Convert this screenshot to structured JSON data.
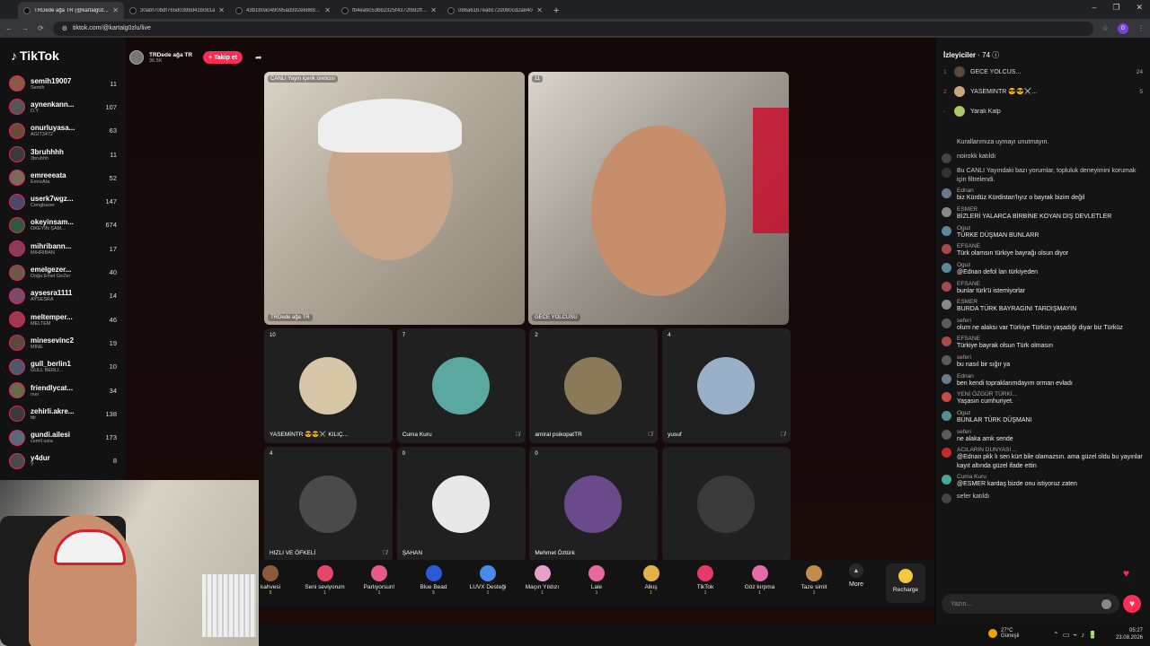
{
  "browser": {
    "tabs": [
      {
        "title": "TRDede ağa TR (@kartalg0z...",
        "active": true
      },
      {
        "title": "30abf70bdf765d0398d41b081a...",
        "active": false
      },
      {
        "title": "43b1b0a049095ad392e6869...",
        "active": false
      },
      {
        "title": "fb4ea9c53bb2325f4372fb92ff...",
        "active": false
      },
      {
        "title": "086a61b7eabc72d080cd2a840...",
        "active": false
      }
    ],
    "url": "tiktok.com/@kartalg0zlu/live",
    "profile_initial": "G"
  },
  "sidebar": {
    "logo": "TikTok",
    "following": [
      {
        "name": "semih19007",
        "sub": "Semih",
        "count": "11",
        "color": "#8a5a44"
      },
      {
        "name": "aynenkann...",
        "sub": "D.Y",
        "count": "107",
        "color": "#555"
      },
      {
        "name": "onurluyasa...",
        "sub": "AĞIT3472",
        "count": "63",
        "color": "#6b4a3a"
      },
      {
        "name": "3bruhhhh",
        "sub": "3bruhhh",
        "count": "11",
        "color": "#3a3a3a"
      },
      {
        "name": "emreeeata",
        "sub": "EmreAta",
        "count": "52",
        "color": "#7a6a5a"
      },
      {
        "name": "userk7wgz...",
        "sub": "Cengbazer",
        "count": "147",
        "color": "#4a4a6a"
      },
      {
        "name": "okeyinsam...",
        "sub": "OKEYİN ŞAM...",
        "count": "674",
        "color": "#2f5a3a"
      },
      {
        "name": "mihribann...",
        "sub": "MİHRİBAN",
        "count": "17",
        "color": "#8a3a5a"
      },
      {
        "name": "emelgezer...",
        "sub": "Doğa Emel GeZer",
        "count": "40",
        "color": "#6a5a4a"
      },
      {
        "name": "aysesra1111",
        "sub": "AYSESRA",
        "count": "14",
        "color": "#7a4a6a"
      },
      {
        "name": "meltemper...",
        "sub": "MELTEM",
        "count": "46",
        "color": "#a03a4a"
      },
      {
        "name": "minesevinc2",
        "sub": "MİNE",
        "count": "19",
        "color": "#5a4a3a"
      },
      {
        "name": "gull_berlin1",
        "sub": "GÜLL BERLİ...",
        "count": "10",
        "color": "#4a5a6a"
      },
      {
        "name": "friendlycat...",
        "sub": "mei",
        "count": "34",
        "color": "#6a6a4a"
      },
      {
        "name": "zehirli.akre...",
        "sub": "ttir",
        "count": "138",
        "color": "#3a3a3a"
      },
      {
        "name": "gundi.ailesi",
        "sub": "cemil usta",
        "count": "173",
        "color": "#5a6a7a"
      },
      {
        "name": "y4dur",
        "sub": "Y",
        "count": "8",
        "color": "#4a4a4a"
      }
    ]
  },
  "live": {
    "host_name": "TRDede ağa TR",
    "host_viewers": "36.5K",
    "follow_label": "+ Takip et",
    "main_tiles": [
      {
        "badge": "CANLI Yayın içerik üreticisi",
        "name": "TRDede ağa TR"
      },
      {
        "badge": "11",
        "name": "GECE YOLCUSU"
      }
    ],
    "small_tiles": [
      {
        "count": "10",
        "name": "YASEMİNTR 😎😎⚔️ KILIÇ...",
        "color": "#d8c7a6",
        "muted": false
      },
      {
        "count": "7",
        "name": "Cuma Kuru",
        "color": "#5aa8a0",
        "muted": true
      },
      {
        "count": "2",
        "name": "amiral psikopatTR",
        "color": "#8a7a5a",
        "muted": true
      },
      {
        "count": "4",
        "name": "yusuf",
        "color": "#9ab0c8",
        "muted": true
      },
      {
        "count": "4",
        "name": "HIZLI VE ÖFKELİ",
        "color": "#4a4a4a",
        "muted": true
      },
      {
        "count": "0",
        "name": "ŞAHAN",
        "color": "#e8e8e8",
        "muted": false
      },
      {
        "count": "0",
        "name": "Mehmet Öztürk",
        "color": "#6a4a8a",
        "muted": false
      },
      {
        "count": "",
        "name": "",
        "color": "#3a3a3a",
        "muted": false
      }
    ]
  },
  "gifts": {
    "items": [
      {
        "name": "kahvesi",
        "price": "5",
        "color": "#8a5a3a"
      },
      {
        "name": "Seni seviyorum",
        "price": "1",
        "color": "#e8476a"
      },
      {
        "name": "Parlıyorsun!",
        "price": "1",
        "color": "#e85a8a"
      },
      {
        "name": "Blue Bead",
        "price": "5",
        "color": "#2a5ad8"
      },
      {
        "name": "LUVX Desteği",
        "price": "1",
        "color": "#4a8ae8"
      },
      {
        "name": "Maçın Yıldızı",
        "price": "1",
        "color": "#e8a0c8"
      },
      {
        "name": "Lale",
        "price": "1",
        "color": "#e86a9a"
      },
      {
        "name": "Alkış",
        "price": "1",
        "color": "#e8b04a"
      },
      {
        "name": "TikTok",
        "price": "1",
        "color": "#e83a6a"
      },
      {
        "name": "Göz kırpma",
        "price": "1",
        "color": "#e86aa8"
      },
      {
        "name": "Taze simit",
        "price": "1",
        "color": "#c88a4a"
      }
    ],
    "more_label": "More",
    "recharge_label": "Recharge"
  },
  "chat": {
    "viewers_label": "İzleyiciler",
    "viewers_count": "74",
    "top_viewers": [
      {
        "rank": "1",
        "name": "GECE YOLCUS...",
        "score": "24",
        "color": "#5a4a3a"
      },
      {
        "rank": "2",
        "name": "YASEMİNTR 😎😎⚔️...",
        "score": "5",
        "color": "#c8a87a"
      },
      {
        "rank": "-",
        "name": "Yaralı Kalp",
        "score": "",
        "color": "#a8c86a"
      }
    ],
    "messages": [
      {
        "user": "",
        "text": "Kurallarımıza uymayı unutmayın.",
        "color": "",
        "sys": true
      },
      {
        "user": "",
        "text": "noirokk  katıldı",
        "color": "#444",
        "sys": true
      },
      {
        "user": "",
        "text": "Bu CANLI Yayındaki bazı yorumlar, topluluk deneyimini korumak için filtrelendi.",
        "color": "#333",
        "sys": true
      },
      {
        "user": "Ednan",
        "text": "biz Kürdüz Kürdistan'lıyız o bayrak bizim değil",
        "color": "#6a7a8a",
        "sys": false
      },
      {
        "user": "ESMER",
        "text": "BİZLERİ YALARCA BİRBİNE KOYAN DIŞ DEVLETLER",
        "color": "#888",
        "sys": false
      },
      {
        "user": "Oguz",
        "text": "TÜRKE DÜŞMAN BUNLARR",
        "color": "#5a8a9a",
        "sys": false
      },
      {
        "user": "EFSANE",
        "text": "Türk olamsın türkiye bayrağı olsun diyor",
        "color": "#a84a4a",
        "sys": false
      },
      {
        "user": "Oguz",
        "text": "@Ednan  defol lan türkiyeden",
        "color": "#5a8a9a",
        "sys": false
      },
      {
        "user": "EFSANE",
        "text": "bunlar türk'ü istemiyorlar",
        "color": "#a84a4a",
        "sys": false
      },
      {
        "user": "ESMER",
        "text": "BURDA TÜRK BAYRAGINI TARDIŞMAYIN",
        "color": "#888",
        "sys": false
      },
      {
        "user": "seferi",
        "text": "olum ne alaksı var Türkiye Türkün yaşadığı diyar biz Türküz",
        "color": "#5a5a5a",
        "sys": false
      },
      {
        "user": "EFSANE",
        "text": "Türkiye bayrak olsun Türk olmasın",
        "color": "#a84a4a",
        "sys": false
      },
      {
        "user": "seferi",
        "text": "bu nasıl bir sığır ya",
        "color": "#5a5a5a",
        "sys": false
      },
      {
        "user": "Ednan",
        "text": "ben kendi topraklarımdayım orman evladı",
        "color": "#6a7a8a",
        "sys": false
      },
      {
        "user": "YENİ ÖZGÜR TÜRKİ...",
        "text": "Yaşasın cumhuriyet.",
        "color": "#c84a4a",
        "sys": false
      },
      {
        "user": "Oguz",
        "text": "BUNLAR TÜRK DÜŞMANI",
        "color": "#5a8a9a",
        "sys": false
      },
      {
        "user": "seferi",
        "text": "ne alaka amk sende",
        "color": "#5a5a5a",
        "sys": false
      },
      {
        "user": "ACILARIN DUNYASI ...",
        "text": "@Ednan  pkk lı sen kürt bile olamazsın. ama güzel oldu bu yayınlar kayıt altında güzel ifade ettin",
        "color": "#c82a2a",
        "sys": false
      },
      {
        "user": "Cuma Kuru",
        "text": "@ESMER kardaş bizde onu istiyoruz zaten",
        "color": "#4aa89a",
        "sys": false
      },
      {
        "user": "",
        "text": "sefer  katıldı",
        "color": "#444",
        "sys": true
      }
    ],
    "input_placeholder": "Yazın..."
  },
  "taskbar": {
    "temp": "27°C",
    "weather": "Güneşli",
    "time": "05:27",
    "date": "23.08.2026"
  }
}
